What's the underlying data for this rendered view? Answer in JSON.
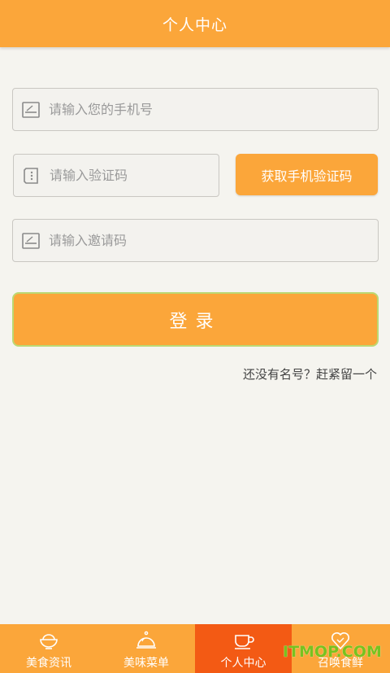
{
  "header": {
    "title": "个人中心"
  },
  "form": {
    "phone_placeholder": "请输入您的手机号",
    "code_placeholder": "请输入验证码",
    "get_code_label": "获取手机验证码",
    "invite_placeholder": "请输入邀请码",
    "login_label": "登录",
    "register_link": "还没有名号？赶紧留一个"
  },
  "tabs": [
    {
      "label": "美食资讯",
      "icon": "rice-bowl-icon",
      "active": false
    },
    {
      "label": "美味菜单",
      "icon": "cloche-icon",
      "active": false
    },
    {
      "label": "个人中心",
      "icon": "cup-icon",
      "active": true
    },
    {
      "label": "召唤食鲜",
      "icon": "heart-icon",
      "active": false
    }
  ],
  "watermark": "ITMOP.COM",
  "colors": {
    "accent": "#fba63a",
    "active_tab": "#f35a14",
    "background": "#f5f4ef"
  }
}
